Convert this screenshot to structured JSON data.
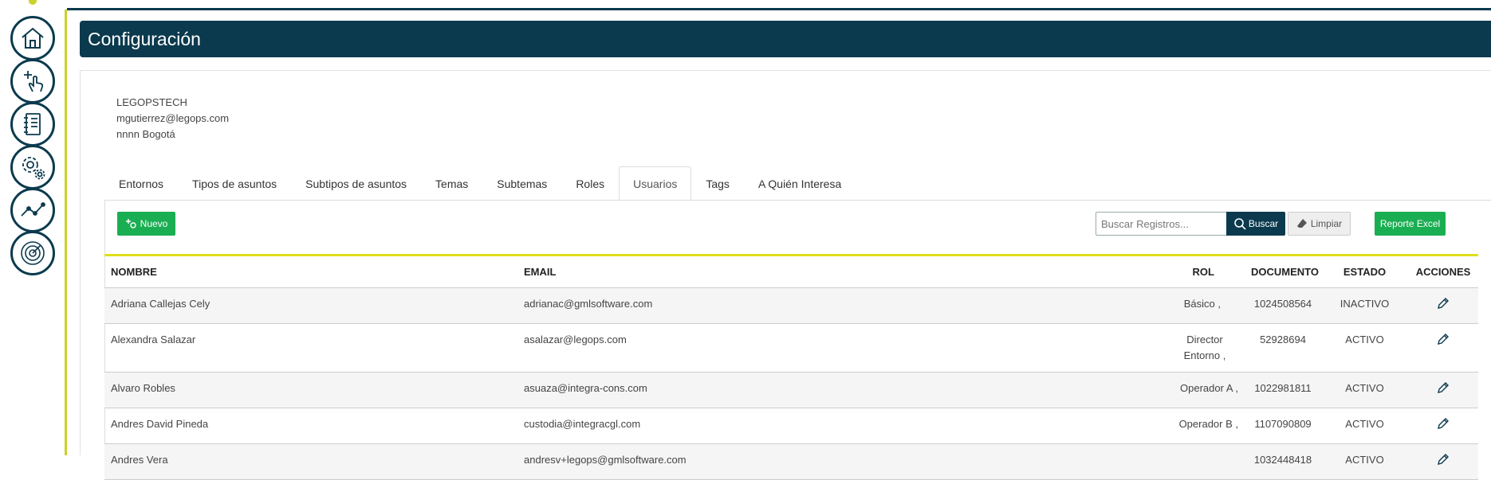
{
  "header": {
    "title": "Configuración"
  },
  "info": {
    "line1": "LEGOPSTECH",
    "line2": "mgutierrez@legops.com",
    "line3": "nnnn Bogotá"
  },
  "rail": {
    "items": [
      {
        "icon": "home-icon"
      },
      {
        "icon": "add-touch-icon"
      },
      {
        "icon": "notebook-icon"
      },
      {
        "icon": "gears-icon"
      },
      {
        "icon": "line-chart-icon"
      },
      {
        "icon": "radar-icon"
      }
    ]
  },
  "tabs": [
    {
      "label": "Entornos"
    },
    {
      "label": "Tipos de asuntos"
    },
    {
      "label": "Subtipos de asuntos"
    },
    {
      "label": "Temas"
    },
    {
      "label": "Subtemas"
    },
    {
      "label": "Roles"
    },
    {
      "label": "Usuarios",
      "active": true
    },
    {
      "label": "Tags"
    },
    {
      "label": "A Quién Interesa"
    }
  ],
  "toolbar": {
    "new_label": "Nuevo",
    "search_placeholder": "Buscar Registros...",
    "search_label": "Buscar",
    "clear_label": "Limpiar",
    "excel_label": "Reporte Excel"
  },
  "table": {
    "headers": {
      "name": "NOMBRE",
      "email": "EMAIL",
      "rol": "ROL",
      "doc": "DOCUMENTO",
      "estado": "ESTADO",
      "acciones": "ACCIONES"
    },
    "rows": [
      {
        "name": "Adriana Callejas Cely",
        "email": "adrianac@gmlsoftware.com",
        "rol": "Básico ,",
        "doc": "1024508564",
        "estado": "INACTIVO"
      },
      {
        "name": "Alexandra Salazar",
        "email": "asalazar@legops.com",
        "rol": "Director Entorno ,",
        "doc": "52928694",
        "estado": "ACTIVO"
      },
      {
        "name": "Alvaro Robles",
        "email": "asuaza@integra-cons.com",
        "rol": "Operador A ,",
        "doc": "1022981811",
        "estado": "ACTIVO"
      },
      {
        "name": "Andres David Pineda",
        "email": "custodia@integracgl.com",
        "rol": "Operador B ,",
        "doc": "1107090809",
        "estado": "ACTIVO"
      },
      {
        "name": "Andres Vera",
        "email": "andresv+legops@gmlsoftware.com",
        "rol": "",
        "doc": "1032448418",
        "estado": "ACTIVO"
      }
    ]
  },
  "colors": {
    "navy": "#0b3a4e",
    "green": "#1aae52",
    "lime": "#c8d32a",
    "yellow_rule": "#e0de1c"
  }
}
